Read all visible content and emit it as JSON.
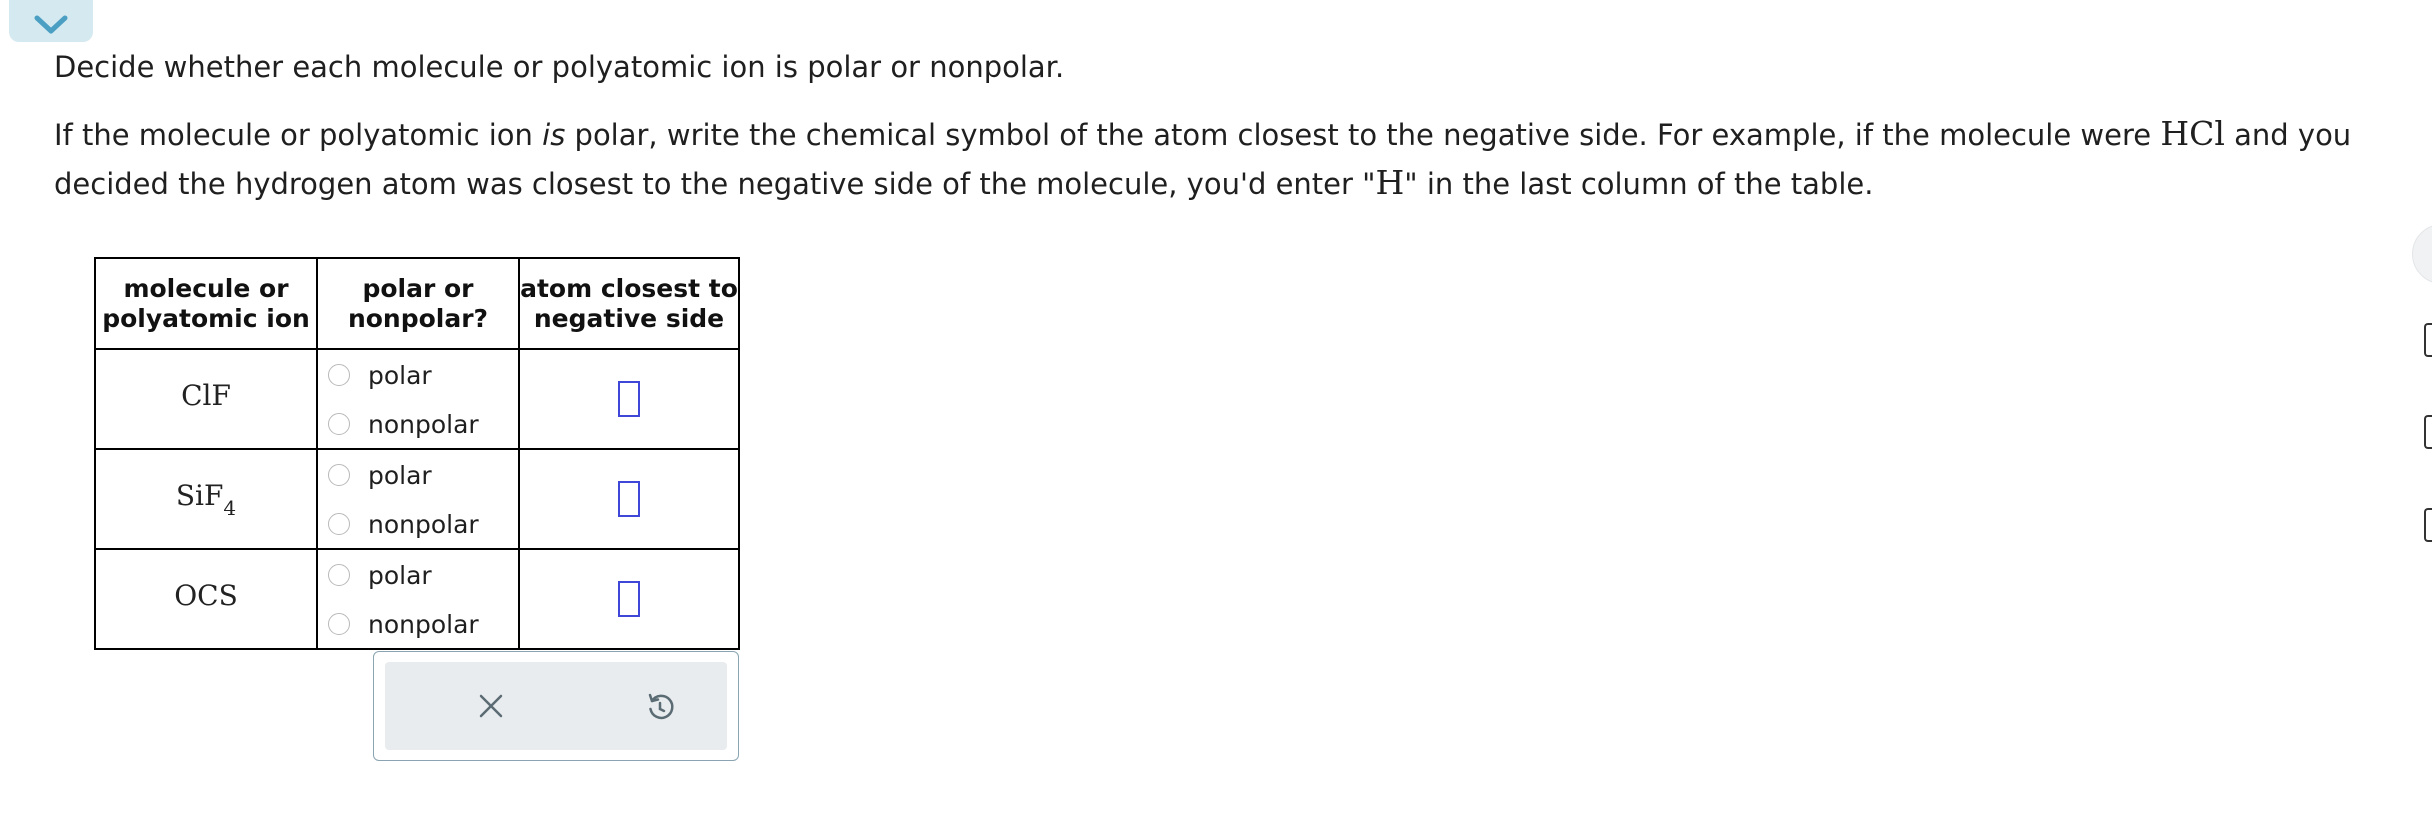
{
  "instructions": {
    "line1": "Decide whether each molecule or polyatomic ion is polar or nonpolar.",
    "line2_part1": "If the molecule or polyatomic ion ",
    "line2_italic": "is",
    "line2_part2": " polar, write the chemical symbol of the atom closest to the negative side. For example, if the molecule were ",
    "example_formula": "HCl",
    "line2_part3": " and you decided the hydrogen atom was closest to the negative side of the molecule, you'd enter \"",
    "example_atom": "H",
    "line2_part4": "\" in the last column of the table."
  },
  "table": {
    "headers": {
      "molecule_line1": "molecule or",
      "molecule_line2": "polyatomic ion",
      "polar_line1": "polar or",
      "polar_line2": "nonpolar?",
      "atom_line1": "atom closest to",
      "atom_line2": "negative side"
    },
    "rows": [
      {
        "molecule": "ClF",
        "molecule_sub": "",
        "option_polar": "polar",
        "option_nonpolar": "nonpolar",
        "atom_value": ""
      },
      {
        "molecule": "SiF",
        "molecule_sub": "4",
        "option_polar": "polar",
        "option_nonpolar": "nonpolar",
        "atom_value": ""
      },
      {
        "molecule": "OCS",
        "molecule_sub": "",
        "option_polar": "polar",
        "option_nonpolar": "nonpolar",
        "atom_value": ""
      }
    ]
  },
  "toolbar": {
    "clear_icon": "x-icon",
    "undo_icon": "undo-icon"
  },
  "colors": {
    "accent": "#3f47d8",
    "tab": "#d5e9f1",
    "tab_chevron": "#4b9fc2"
  }
}
